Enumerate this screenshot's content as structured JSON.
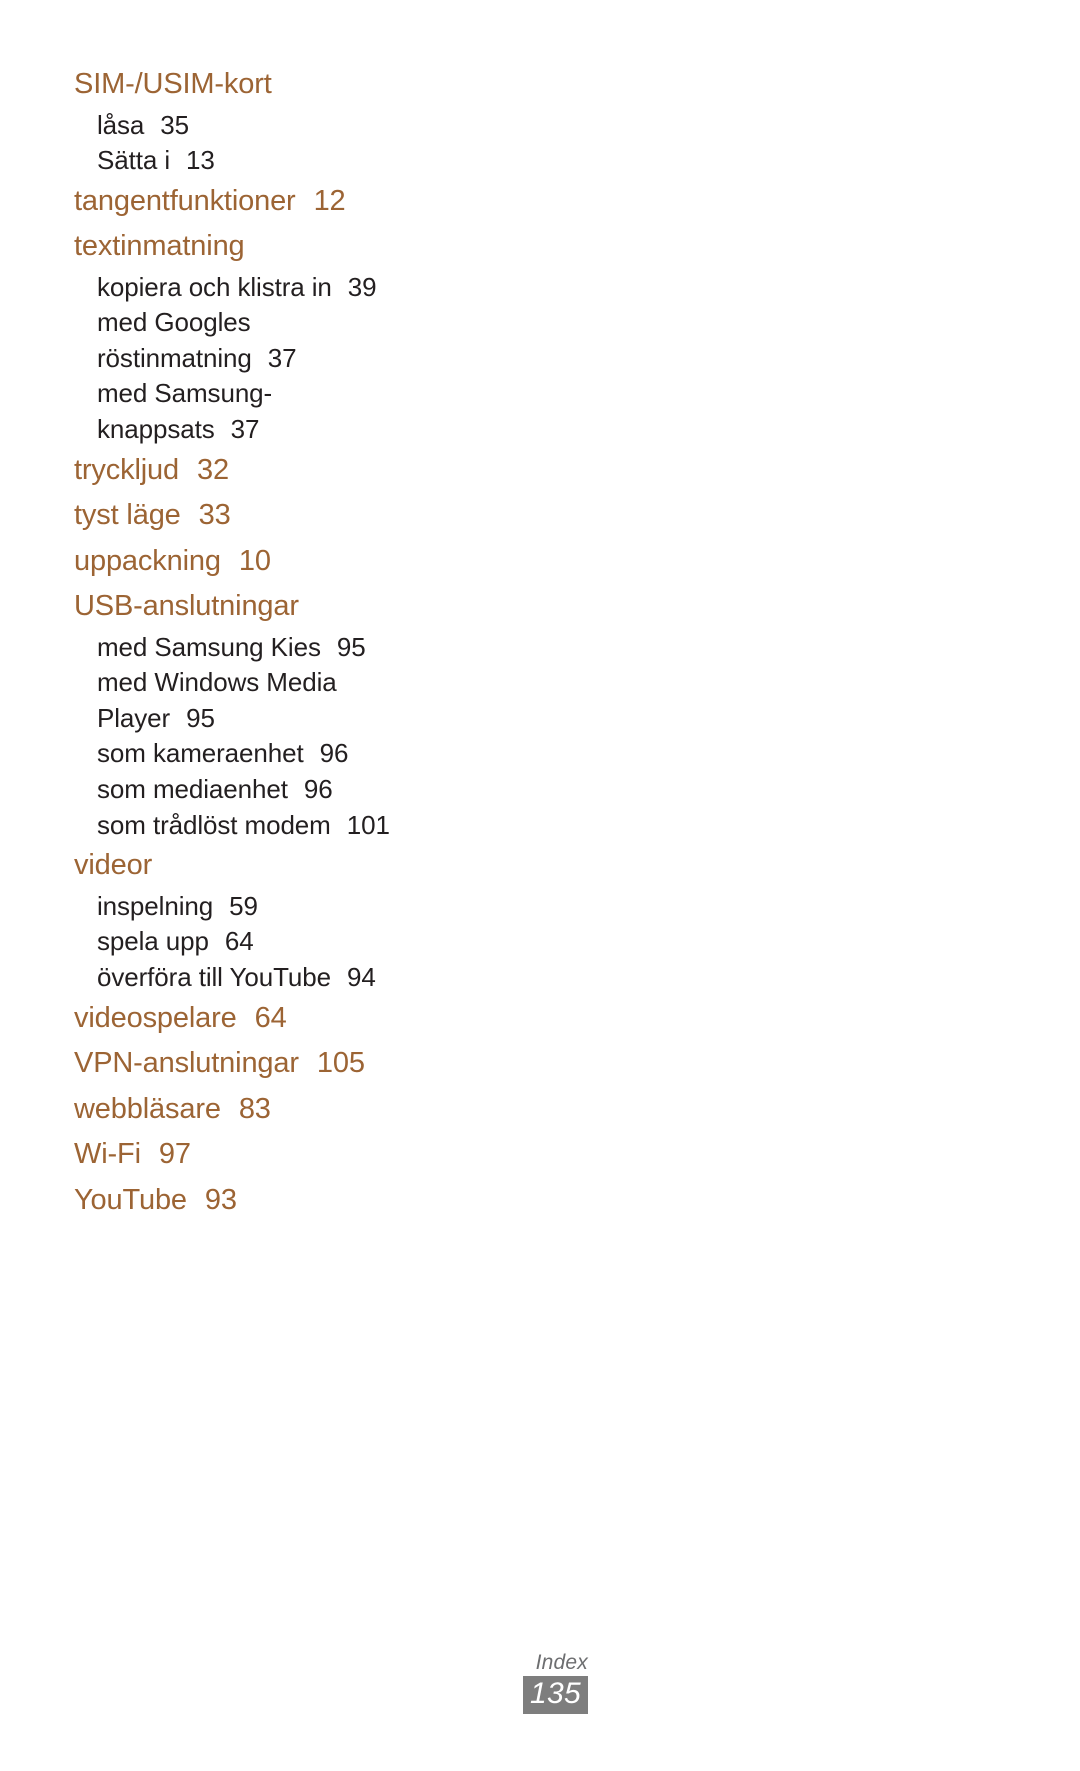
{
  "document": {
    "kind": "manual-index-page",
    "language": "sv",
    "background_color": "#FFFFFF",
    "heading_color": "#9C6434",
    "subentry_color": "#231F20",
    "footer_label_color": "#6D6E70",
    "footer_badge_color": "#7E7E7E"
  },
  "index": {
    "groups": [
      {
        "label": "SIM-/USIM-kort",
        "page": "",
        "sub": [
          {
            "label": "låsa",
            "page": "35"
          },
          {
            "label": "Sätta i",
            "page": "13"
          }
        ]
      },
      {
        "label": "tangentfunktioner",
        "page": "12",
        "sub": []
      },
      {
        "label": "textinmatning",
        "page": "",
        "sub": [
          {
            "label": "kopiera och klistra in",
            "page": "39"
          },
          {
            "label": "med Googles",
            "page": ""
          },
          {
            "label": "röstinmatning",
            "page": "37"
          },
          {
            "label": "med Samsung-",
            "page": ""
          },
          {
            "label": "knappsats",
            "page": "37"
          }
        ]
      },
      {
        "label": "tryckljud",
        "page": "32",
        "sub": []
      },
      {
        "label": "tyst läge",
        "page": "33",
        "sub": []
      },
      {
        "label": "uppackning",
        "page": "10",
        "sub": []
      },
      {
        "label": "USB-anslutningar",
        "page": "",
        "sub": [
          {
            "label": "med Samsung Kies",
            "page": "95"
          },
          {
            "label": "med Windows Media",
            "page": ""
          },
          {
            "label": "Player",
            "page": "95"
          },
          {
            "label": "som kameraenhet",
            "page": "96"
          },
          {
            "label": "som mediaenhet",
            "page": "96"
          },
          {
            "label": "som trådlöst modem",
            "page": "101"
          }
        ]
      },
      {
        "label": "videor",
        "page": "",
        "sub": [
          {
            "label": "inspelning",
            "page": "59"
          },
          {
            "label": "spela upp",
            "page": "64"
          },
          {
            "label": "överföra till YouTube",
            "page": "94"
          }
        ]
      },
      {
        "label": "videospelare",
        "page": "64",
        "sub": []
      },
      {
        "label": "VPN-anslutningar",
        "page": "105",
        "sub": []
      },
      {
        "label": "webbläsare",
        "page": "83",
        "sub": []
      },
      {
        "label": "Wi-Fi",
        "page": "97",
        "sub": []
      },
      {
        "label": "YouTube",
        "page": "93",
        "sub": []
      }
    ]
  },
  "footer": {
    "section_label": "Index",
    "page_number": "135"
  }
}
